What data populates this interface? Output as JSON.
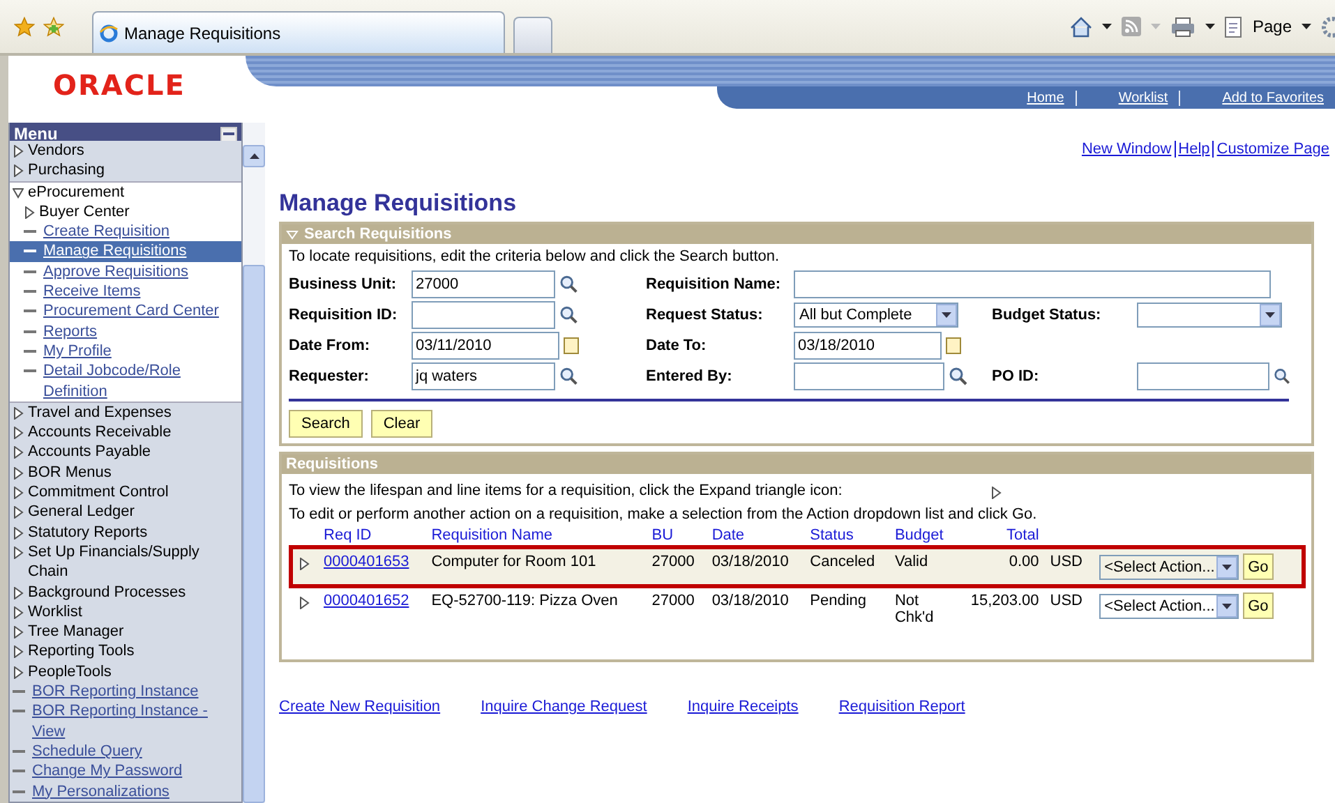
{
  "browser": {
    "tab_title": "Manage Requisitions",
    "page_menu": "Page"
  },
  "header": {
    "logo": "ORACLE",
    "nav": [
      "Home",
      "Worklist",
      "Add to Favorites"
    ]
  },
  "sidebar": {
    "title": "Menu",
    "items": [
      {
        "label": "Vendors",
        "kind": "folder",
        "expanded": false,
        "selected": false
      },
      {
        "label": "Purchasing",
        "kind": "folder",
        "expanded": false,
        "selected": false
      },
      {
        "label": "eProcurement",
        "kind": "folder",
        "expanded": true,
        "selected": false,
        "children": [
          {
            "label": "Buyer Center",
            "kind": "folder",
            "expanded": false,
            "selected": false
          },
          {
            "label": "Create Requisition",
            "kind": "link",
            "selected": false
          },
          {
            "label": "Manage Requisitions",
            "kind": "link",
            "selected": true
          },
          {
            "label": "Approve Requisitions",
            "kind": "link",
            "selected": false
          },
          {
            "label": "Receive Items",
            "kind": "link",
            "selected": false
          },
          {
            "label": "Procurement Card Center",
            "kind": "link",
            "selected": false
          },
          {
            "label": "Reports",
            "kind": "link",
            "selected": false
          },
          {
            "label": "My Profile",
            "kind": "link",
            "selected": false
          },
          {
            "label": "Detail Jobcode/Role Definition",
            "kind": "link",
            "selected": false
          }
        ]
      },
      {
        "label": "Travel and Expenses",
        "kind": "folder",
        "expanded": false,
        "selected": false
      },
      {
        "label": "Accounts Receivable",
        "kind": "folder",
        "expanded": false,
        "selected": false
      },
      {
        "label": "Accounts Payable",
        "kind": "folder",
        "expanded": false,
        "selected": false
      },
      {
        "label": "BOR Menus",
        "kind": "folder",
        "expanded": false,
        "selected": false
      },
      {
        "label": "Commitment  Control",
        "kind": "folder",
        "expanded": false,
        "selected": false
      },
      {
        "label": "General Ledger",
        "kind": "folder",
        "expanded": false,
        "selected": false
      },
      {
        "label": "Statutory Reports",
        "kind": "folder",
        "expanded": false,
        "selected": false
      },
      {
        "label": "Set Up Financials/Supply Chain",
        "kind": "folder",
        "expanded": false,
        "selected": false
      },
      {
        "label": "Background Processes",
        "kind": "folder",
        "expanded": false,
        "selected": false
      },
      {
        "label": "Worklist",
        "kind": "folder",
        "expanded": false,
        "selected": false
      },
      {
        "label": "Tree Manager",
        "kind": "folder",
        "expanded": false,
        "selected": false
      },
      {
        "label": "Reporting Tools",
        "kind": "folder",
        "expanded": false,
        "selected": false
      },
      {
        "label": "PeopleTools",
        "kind": "folder",
        "expanded": false,
        "selected": false
      },
      {
        "label": "BOR Reporting Instance",
        "kind": "link",
        "selected": false
      },
      {
        "label": "BOR Reporting Instance - View",
        "kind": "link",
        "selected": false
      },
      {
        "label": "Schedule Query",
        "kind": "link",
        "selected": false
      },
      {
        "label": "Change My Password",
        "kind": "link",
        "selected": false
      },
      {
        "label": "My Personalizations",
        "kind": "link",
        "selected": false
      }
    ]
  },
  "top_links": [
    "New Window",
    "Help",
    "Customize Page"
  ],
  "page_title": "Manage Requisitions",
  "search": {
    "title": "Search Requisitions",
    "expanded": true,
    "instructions": "To locate requisitions, edit the criteria below and click the Search button.",
    "fields": [
      {
        "label": "Business Unit:",
        "kind": "lookup",
        "value": "27000"
      },
      {
        "label": "Requisition Name:",
        "kind": "wide"
      },
      {
        "label": "Requisition ID:",
        "kind": "lookup"
      },
      {
        "label": "Request Status:",
        "kind": "select",
        "value": "All but Complete"
      },
      {
        "label": "Budget Status:",
        "kind": "select"
      },
      {
        "label": "Date From:",
        "kind": "date",
        "value": "03/11/2010"
      },
      {
        "label": "Date To:",
        "kind": "date",
        "value": "03/18/2010"
      },
      {
        "label": "Requester:",
        "kind": "lookup",
        "value": "jq waters"
      },
      {
        "label": "Entered By:",
        "kind": "lookup"
      },
      {
        "label": "PO ID:",
        "kind": "lookup"
      }
    ],
    "buttons": [
      "Search",
      "Clear"
    ]
  },
  "requisitions": {
    "title": "Requisitions",
    "hint_expand": "To view the lifespan and line items for a requisition, click the Expand triangle icon:",
    "hint_action": "To edit or perform another action on a requisition, make a selection from the Action dropdown list and click Go.",
    "columns": [
      "Req ID",
      "Requisition Name",
      "BU",
      "Date",
      "Status",
      "Budget",
      "Total"
    ],
    "rows": [
      {
        "selected": true,
        "req_id": "0000401653",
        "name": "Computer for Room 101",
        "bu": "27000",
        "date": "03/18/2010",
        "status": "Canceled",
        "budget": "Valid",
        "total": "0.00",
        "currency": "USD",
        "action": "<Select Action...",
        "go": "Go"
      },
      {
        "selected": false,
        "req_id": "0000401652",
        "name": "EQ-52700-119: Pizza Oven",
        "bu": "27000",
        "date": "03/18/2010",
        "status": "Pending",
        "budget": "Not Chk'd",
        "total": "15,203.00",
        "currency": "USD",
        "action": "<Select Action...",
        "go": "Go"
      }
    ]
  },
  "bottom_links": [
    "Create New Requisition",
    "Inquire Change Request",
    "Inquire Receipts",
    "Requisition Report"
  ]
}
